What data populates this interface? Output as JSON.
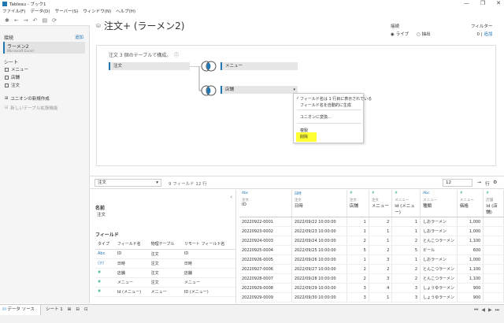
{
  "window": {
    "title": "Tableau - ブック1",
    "controls": [
      "—",
      "❐",
      "✕"
    ]
  },
  "menu": [
    "ファイル(F)",
    "データ(D)",
    "サーバー(S)",
    "ウィンドウ(N)",
    "ヘルプ(H)"
  ],
  "left": {
    "connections_label": "接続",
    "add_label": "追加",
    "connection": {
      "name": "ラーメン2",
      "subtitle": "Microsoft Excel"
    },
    "sheets_label": "シート",
    "sheets": [
      "メニュー",
      "店舗",
      "注文"
    ],
    "new_union": "ユニオンの新規作成",
    "new_table_ext": "新しいテーブル拡張機能"
  },
  "header": {
    "title": "注文+ (ラーメン2)",
    "connection_label": "接続",
    "live": "ライブ",
    "extract": "抽出",
    "filter_label": "フィルター",
    "filter_count": "0",
    "filter_add": "追加"
  },
  "canvas": {
    "caption": "注文 3 個のテーブルで構成。",
    "tables": {
      "order": "注文",
      "menu": "メニュー",
      "store": "店舗"
    },
    "context_menu": {
      "item1": "フィールド名は 1 行目に表示されている",
      "item2": "フィールド名を自動的に生成",
      "item3": "ユニオンに変換...",
      "item4": "複製",
      "item5": "削除"
    }
  },
  "grid_header": {
    "selected_table": "注文",
    "summary": "9 フィールド 12 行",
    "rows": "12",
    "rows_label": "行"
  },
  "meta": {
    "name_label": "名前",
    "name_value": "注文",
    "fields_label": "フィールド",
    "columns": [
      "タイプ",
      "フィールド名",
      "物理テーブル",
      "リモート フィールド名"
    ],
    "rows": [
      {
        "type": "Abc",
        "field": "ID",
        "table": "注文",
        "remote": "ID"
      },
      {
        "type": "日付",
        "field": "日時",
        "table": "注文",
        "remote": "日時"
      },
      {
        "type": "#",
        "field": "店舗",
        "table": "注文",
        "remote": "店舗"
      },
      {
        "type": "#",
        "field": "メニュー",
        "table": "注文",
        "remote": "メニュー"
      },
      {
        "type": "#",
        "field": "Id (メニュー)",
        "table": "メニュー",
        "remote": "ID (メニュー)"
      }
    ]
  },
  "grid": {
    "columns": [
      {
        "type": "Abc",
        "source": "注文",
        "name": "ID"
      },
      {
        "type": "日時",
        "source": "注文",
        "name": "日時"
      },
      {
        "type": "#",
        "source": "注文",
        "name": "店舗"
      },
      {
        "type": "#",
        "source": "注文",
        "name": "メニュー"
      },
      {
        "type": "#",
        "source": "メニュー",
        "name": "Id (メニュー)"
      },
      {
        "type": "Abc",
        "source": "メニュー",
        "name": "種類"
      },
      {
        "type": "#",
        "source": "メニュー",
        "name": "価格"
      },
      {
        "type": "#",
        "source": "店舗",
        "name": "Id (店舗)"
      }
    ],
    "rows": [
      [
        "20220922-0001",
        "2022/09/22 10:00:00",
        "1",
        "2",
        "1",
        "しおラーメン",
        "1,000"
      ],
      [
        "20220923-0002",
        "2022/09/23 10:00:00",
        "1",
        "1",
        "1",
        "しおラーメン",
        "1,000"
      ],
      [
        "20220924-0003",
        "2022/09/24 10:00:00",
        "2",
        "1",
        "2",
        "とんこつラーメン",
        "1,100"
      ],
      [
        "20220925-0004",
        "2022/09/25 10:00:00",
        "5",
        "2",
        "5",
        "ビール",
        "600"
      ],
      [
        "20220926-0005",
        "2022/09/26 10:00:00",
        "1",
        "3",
        "1",
        "しおラーメン",
        "1,000"
      ],
      [
        "20220927-0006",
        "2022/09/27 10:00:00",
        "2",
        "2",
        "2",
        "とんこつラーメン",
        "1,100"
      ],
      [
        "20220928-0007",
        "2022/09/28 10:00:00",
        "2",
        "3",
        "2",
        "とんこつラーメン",
        "1,100"
      ],
      [
        "20220929-0008",
        "2022/09/29 10:00:00",
        "3",
        "4",
        "3",
        "しょうゆラーメン",
        "900"
      ],
      [
        "20220929-0009",
        "2022/09/30 10:00:00",
        "3",
        "1",
        "3",
        "しょうゆラーメン",
        "900"
      ]
    ]
  },
  "bottom": {
    "data_source_tab": "データ ソース",
    "sheet_tab": "シート 1"
  },
  "colors": {
    "accent": "#1f77b4",
    "highlight": "#ffff33",
    "measure": "#2ca58d"
  }
}
